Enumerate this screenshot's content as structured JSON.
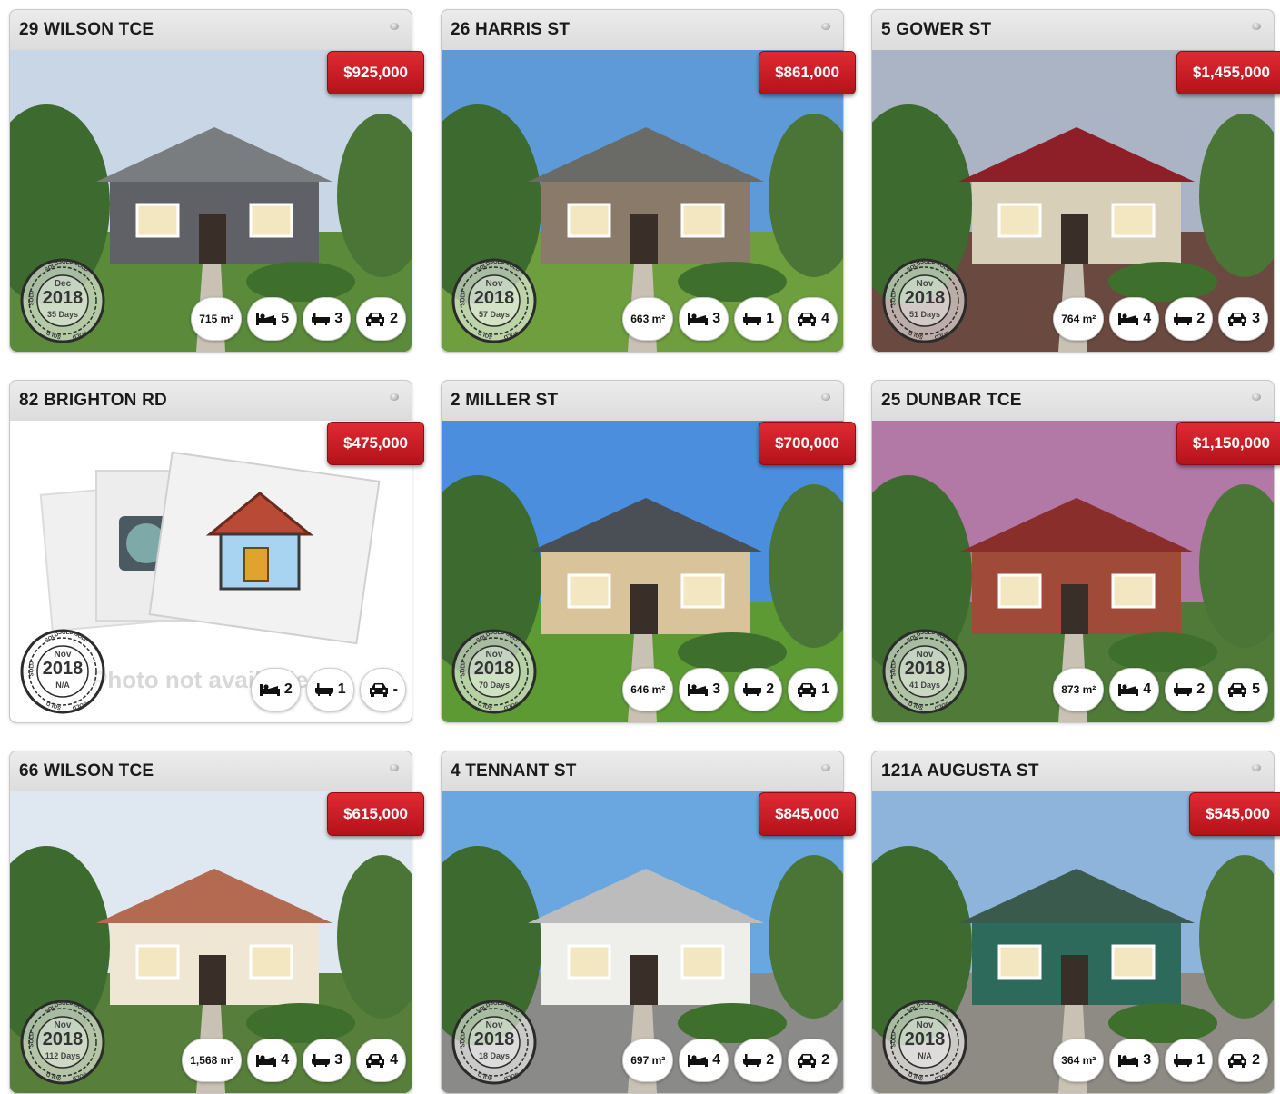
{
  "listings": [
    {
      "address": "29 WILSON TCE",
      "price": "$925,000",
      "stamp": {
        "month": "Dec",
        "year": "2018",
        "days": "35 Days"
      },
      "land": "715 m²",
      "beds": "5",
      "baths": "3",
      "cars": "2",
      "photo": "house-photo",
      "colors": {
        "sky": "#c8d6e6",
        "house": "#5f6166",
        "roof": "#7a7d80",
        "ground": "#5a8a3a"
      }
    },
    {
      "address": "26 HARRIS ST",
      "price": "$861,000",
      "stamp": {
        "month": "Nov",
        "year": "2018",
        "days": "57 Days"
      },
      "land": "663 m²",
      "beds": "3",
      "baths": "1",
      "cars": "4",
      "photo": "house-photo",
      "colors": {
        "sky": "#5f9ad8",
        "house": "#8a7a6a",
        "roof": "#6a6a66",
        "ground": "#6e9e3e"
      }
    },
    {
      "address": "5 GOWER ST",
      "price": "$1,455,000",
      "stamp": {
        "month": "Nov",
        "year": "2018",
        "days": "51 Days"
      },
      "land": "764 m²",
      "beds": "4",
      "baths": "2",
      "cars": "3",
      "photo": "house-photo",
      "colors": {
        "sky": "#aab4c4",
        "house": "#d8cfb8",
        "roof": "#8e1e28",
        "ground": "#6a4a40"
      }
    },
    {
      "address": "82 BRIGHTON RD",
      "price": "$475,000",
      "stamp": {
        "month": "Nov",
        "year": "2018",
        "days": "N/A"
      },
      "land": "",
      "beds": "2",
      "baths": "1",
      "cars": "-",
      "photo": "no-photo",
      "placeholder_text": "Photo not available",
      "colors": {
        "sky": "#ffffff",
        "house": "#ffffff",
        "roof": "#ffffff",
        "ground": "#ffffff"
      }
    },
    {
      "address": "2 MILLER ST",
      "price": "$700,000",
      "stamp": {
        "month": "Nov",
        "year": "2018",
        "days": "70 Days"
      },
      "land": "646 m²",
      "beds": "3",
      "baths": "2",
      "cars": "1",
      "photo": "house-photo",
      "colors": {
        "sky": "#4c8ede",
        "house": "#d9c39a",
        "roof": "#4a4e55",
        "ground": "#5e9a34"
      }
    },
    {
      "address": "25 DUNBAR TCE",
      "price": "$1,150,000",
      "stamp": {
        "month": "Nov",
        "year": "2018",
        "days": "41 Days"
      },
      "land": "873 m²",
      "beds": "4",
      "baths": "2",
      "cars": "5",
      "photo": "house-photo",
      "colors": {
        "sky": "#b278a6",
        "house": "#a04a3a",
        "roof": "#8a2e2c",
        "ground": "#4f7a38"
      }
    },
    {
      "address": "66 WILSON TCE",
      "price": "$615,000",
      "stamp": {
        "month": "Nov",
        "year": "2018",
        "days": "112 Days"
      },
      "land": "1,568 m²",
      "beds": "4",
      "baths": "3",
      "cars": "4",
      "photo": "house-photo",
      "colors": {
        "sky": "#dfe8f0",
        "house": "#efe7d4",
        "roof": "#b46a50",
        "ground": "#577e3a"
      }
    },
    {
      "address": "4 TENNANT ST",
      "price": "$845,000",
      "stamp": {
        "month": "Nov",
        "year": "2018",
        "days": "18 Days"
      },
      "land": "697 m²",
      "beds": "4",
      "baths": "2",
      "cars": "2",
      "photo": "house-photo",
      "colors": {
        "sky": "#6aa6e0",
        "house": "#eeeeea",
        "roof": "#bcbcbc",
        "ground": "#8a8a88"
      }
    },
    {
      "address": "121A AUGUSTA ST",
      "price": "$545,000",
      "stamp": {
        "month": "Nov",
        "year": "2018",
        "days": "N/A"
      },
      "land": "364 m²",
      "beds": "3",
      "baths": "1",
      "cars": "2",
      "photo": "house-photo",
      "colors": {
        "sky": "#8fb4dc",
        "house": "#2e6a5c",
        "roof": "#3a5a4e",
        "ground": "#8e8a84"
      }
    }
  ],
  "stamp_word": "SOLD",
  "icons": {
    "bed": "bed-icon",
    "bath": "bath-icon",
    "car": "car-icon",
    "pin": "pin-icon",
    "stamp": "sold-stamp-icon"
  }
}
